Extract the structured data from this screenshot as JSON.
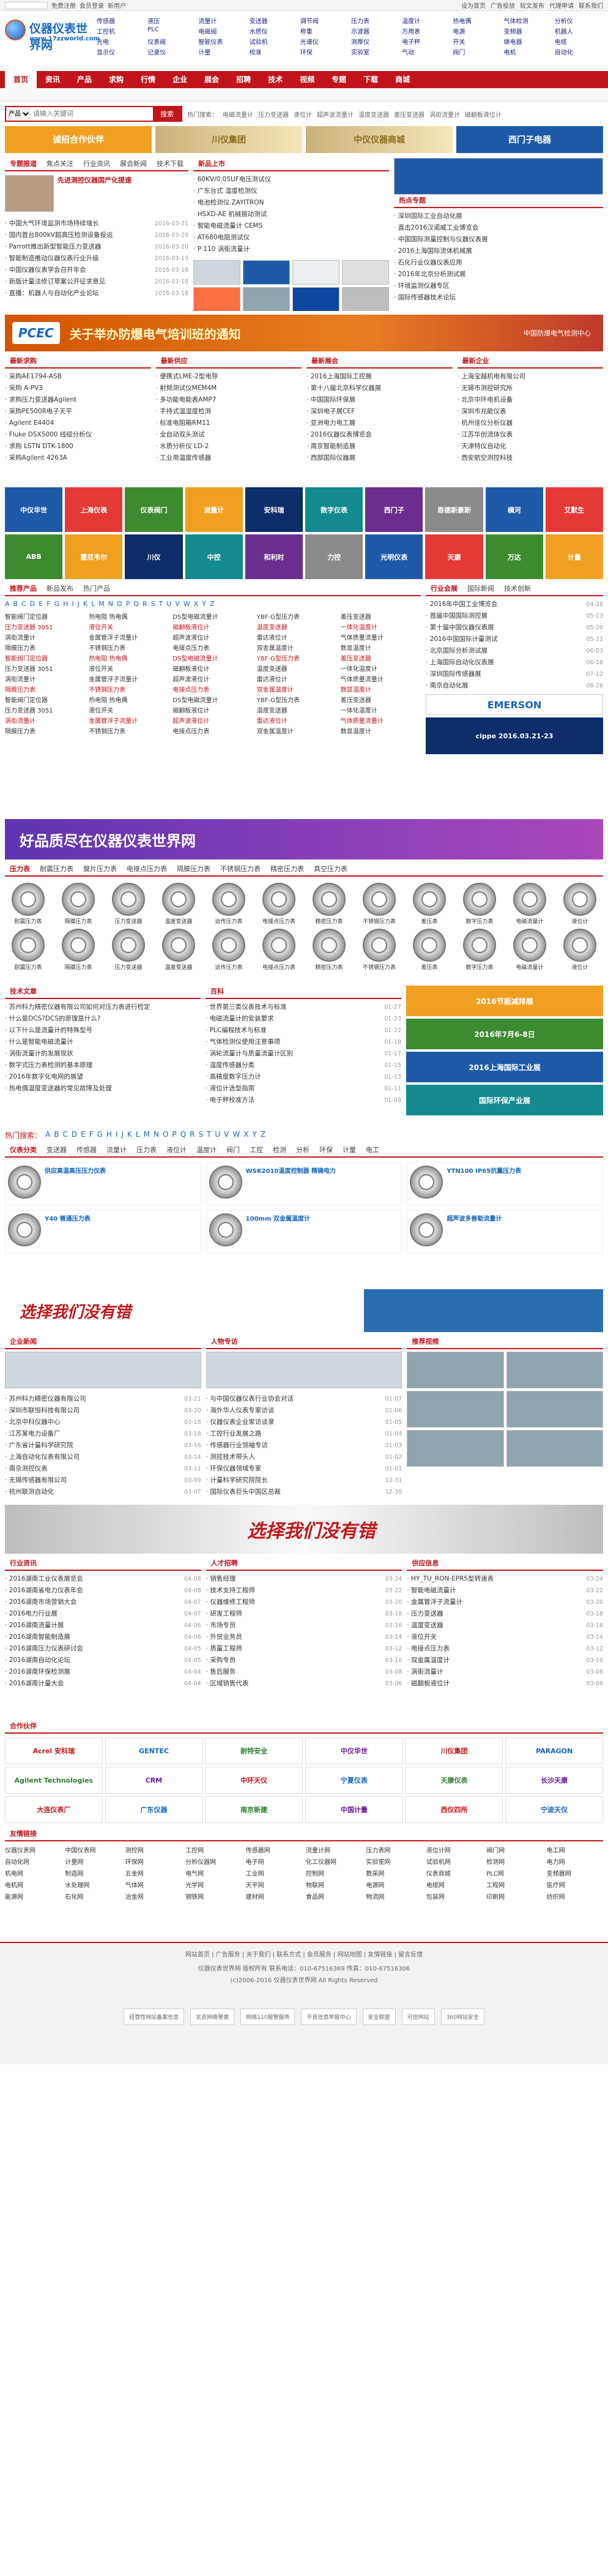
{
  "topbar": {
    "search_placeholder": "",
    "links_left": [
      "免费注册",
      "会员登录",
      "新用户"
    ],
    "links_right": [
      "设为首页",
      "广告投放",
      "软文发布",
      "代理申请",
      "联系我们"
    ]
  },
  "logo": {
    "cn": "仪器仪表世界网",
    "url": "www.17zzworld.com"
  },
  "categories": [
    "传感器",
    "液压",
    "流量计",
    "变送器",
    "调节阀",
    "压力表",
    "温度计",
    "热电偶",
    "气体检测",
    "分析仪",
    "工控机",
    "PLC",
    "电磁阀",
    "水质仪",
    "称重",
    "示波器",
    "万用表",
    "电源",
    "变频器",
    "机器人",
    "光电",
    "仪表阀",
    "智能仪表",
    "试验机",
    "光谱仪",
    "测厚仪",
    "电子秤",
    "开关",
    "继电器",
    "电缆",
    "显示仪",
    "记录仪",
    "计量",
    "校准",
    "环保",
    "实验室",
    "气动",
    "阀门",
    "电机",
    "自动化"
  ],
  "nav": [
    "首页",
    "资讯",
    "产品",
    "求购",
    "行情",
    "企业",
    "展会",
    "招聘",
    "技术",
    "视频",
    "专题",
    "下载",
    "商城"
  ],
  "search": {
    "select": "产品",
    "placeholder": "请输入关键词",
    "button": "搜索",
    "hot": [
      "热门搜索：",
      "电磁流量计",
      "压力变送器",
      "液位计",
      "超声波流量计",
      "温度变送器",
      "差压变送器",
      "涡街流量计",
      "磁翻板液位计"
    ]
  },
  "banners_top": [
    "诚招合作伙伴",
    "川仪集团",
    "中仪仪器商城",
    "西门子电器"
  ],
  "news": {
    "tabs": [
      "专题报道",
      "焦点关注",
      "行业资讯",
      "展会新闻",
      "技术下载"
    ],
    "head_title": "先进测控仪器国产化提速",
    "items": [
      {
        "t": "中国大气环境监测市场持续增长",
        "d": "2016-03-21"
      },
      {
        "t": "国内首台800kV超高压检测设备投运",
        "d": "2016-03-20"
      },
      {
        "t": "Parrott推出新型智能压力变送器",
        "d": "2016-03-20"
      },
      {
        "t": "智能制造推动仪器仪表行业升级",
        "d": "2016-03-19"
      },
      {
        "t": "中国仪器仪表学会召开年会",
        "d": "2016-03-18"
      },
      {
        "t": "新版计量法修订草案公开征求意见",
        "d": "2016-03-18"
      },
      {
        "t": "直播：机器人与自动化产业论坛",
        "d": "2016-03-18"
      }
    ]
  },
  "mid_products": {
    "title": "新品上市",
    "items": [
      "60KV/0.05UF电压测试仪",
      "广东台式 湿度检测仪",
      "电池检测仪 ZAYITRON",
      "HSXD-AE 机械振动测试",
      "智能电磁流量计 CEMS",
      "AT680电阻测试仪",
      "P 110 涡街流量计"
    ]
  },
  "right_topics": {
    "title": "热点专题",
    "items": [
      "深圳国际工业自动化展",
      "直击2016汉诺威工业博览会",
      "中国国际测量控制与仪器仪表展",
      "2016上海国际流体机械展",
      "石化行业仪器仪表应用",
      "2016年北京分析测试展",
      "环境监测仪器专区",
      "国际传感器技术论坛"
    ]
  },
  "pcec": {
    "text": "关于举办防爆电气培训班的通知",
    "sub": "中国防爆电气检测中心"
  },
  "lists4": [
    {
      "tab": "最新求购",
      "items": [
        "采购AE1794-ASB",
        "采购 A-PV3",
        "求购压力变送器Agilent",
        "采购PE500R电子天平",
        "Agilent E4404",
        "Fluke DSX5000 线缆分析仪",
        "求购 LSTN DTK-1800",
        "采购Agilent 4263A"
      ]
    },
    {
      "tab": "最新供应",
      "items": [
        "便携式LME-2型电导",
        "射频测试仪MEM4M",
        "多功能电能表AMP7",
        "手持式温湿度检测",
        "标准电阻箱RM11",
        "全自动双头测试",
        "水质分析仪 LD-2",
        "工业用温度传感器"
      ]
    },
    {
      "tab": "最新展会",
      "items": [
        "2016上海国际工控展",
        "第十八届北京科学仪器展",
        "中国国际环保展",
        "深圳电子展CEF",
        "亚洲电力电工展",
        "2016仪器仪表博览会",
        "南京智能制造展",
        "西部国际仪器展"
      ]
    },
    {
      "tab": "最新企业",
      "items": [
        "上海宝越机电有限公司",
        "无锡市测控研究所",
        "北京中环电机设备",
        "深圳市兆能仪表",
        "杭州佳仪分析仪器",
        "江苏华创流体仪表",
        "天津特仪自动化",
        "西安航空测控科技"
      ]
    }
  ],
  "logo_grid": [
    "中仪华世",
    "上海仪表",
    "仪表阀门",
    "流量计",
    "安科瑞",
    "数字仪表",
    "西门子",
    "恩德斯豪斯",
    "横河",
    "艾默生",
    "ABB",
    "霍尼韦尔",
    "川仪",
    "中控",
    "和利时",
    "力控",
    "光明仪表",
    "天康",
    "万达",
    "计量"
  ],
  "alpha": {
    "tabs": [
      "推荐产品",
      "新品发布",
      "热门产品"
    ],
    "letters": [
      "A",
      "B",
      "C",
      "D",
      "E",
      "F",
      "G",
      "H",
      "I",
      "J",
      "K",
      "L",
      "M",
      "N",
      "O",
      "P",
      "Q",
      "R",
      "S",
      "T",
      "U",
      "V",
      "W",
      "X",
      "Y",
      "Z"
    ]
  },
  "product_lines": [
    [
      "智能阀门定位器",
      "热电阻 热电偶",
      "DS型电磁流量计",
      "YBF-G型压力表",
      "差压变送器"
    ],
    [
      "压力变送器 3051",
      "液位开关",
      "磁翻板液位计",
      "温度变送器",
      "一体化温度计"
    ],
    [
      "涡街流量计",
      "金属管浮子流量计",
      "超声波液位计",
      "雷达液位计",
      "气体质量流量计"
    ],
    [
      "隔膜压力表",
      "不锈钢压力表",
      "电接点压力表",
      "双金属温度计",
      "数显温度计"
    ]
  ],
  "right_side": {
    "tabs": [
      "行业会展",
      "国际新闻",
      "技术创新"
    ],
    "items": [
      "2016年中国工业博览会",
      "首届中国国际测控展",
      "第十届中国仪器仪表展",
      "2016中国国际计量测试",
      "北京国际分析测试展",
      "上海国际自动化仪表展",
      "深圳国际传感器展",
      "南京自动化展"
    ],
    "dates": [
      "04-28",
      "05-13",
      "05-20",
      "05-21",
      "06-03",
      "06-18",
      "07-12",
      "08-26"
    ]
  },
  "emerson": "EMERSON",
  "cippe": "cippe 2016.03.21-23",
  "banner_quality": "好品质尽在仪器仪表世界网",
  "prod_tabs": [
    "压力表",
    "耐震压力表",
    "膜片压力表",
    "电接点压力表",
    "隔膜压力表",
    "不锈钢压力表",
    "精密压力表",
    "真空压力表"
  ],
  "gauges": [
    "耐震压力表",
    "隔膜压力表",
    "压力变送器",
    "温度变送器",
    "远传压力表",
    "电接点压力表",
    "精密压力表",
    "不锈钢压力表",
    "差压表",
    "数字压力表",
    "电磁流量计",
    "液位计"
  ],
  "tech_news": {
    "tab": "技术文章",
    "items": [
      "苏州科力精密仪器有限公司如何对压力表进行检定",
      "什么是DCS?DCS的原理是什么?",
      "以下什么是流量计的特殊型号",
      "什么是智能电磁流量计",
      "涡街流量计的发展现状",
      "数字式压力表检测的基本原理",
      "2016年数字化电网的展望",
      "热电偶温度变送器的常见故障及处理"
    ]
  },
  "tech_news2": {
    "tab": "百科",
    "items": [
      "世界第三类仪表技术与标准",
      "电磁流量计的安装要求",
      "PLC编程技术与标准",
      "气体检测仪使用注意事项",
      "涡轮流量计与质量流量计区别",
      "温度传感器分类",
      "高精度数字压力计",
      "液位计选型指南",
      "电子秤校准方法"
    ],
    "dates": [
      "01-27",
      "01-23",
      "01-22",
      "01-19",
      "01-17",
      "01-15",
      "01-13",
      "01-11",
      "01-09"
    ]
  },
  "expo_right": [
    "2016节能减排展",
    "2016年7月6-8日",
    "2016上海国际工业展",
    "国际环保产业展"
  ],
  "alpha2": {
    "title": "热门搜索：",
    "letters": [
      "A",
      "B",
      "C",
      "D",
      "E",
      "F",
      "G",
      "H",
      "I",
      "J",
      "K",
      "L",
      "M",
      "N",
      "O",
      "P",
      "Q",
      "R",
      "S",
      "T",
      "U",
      "V",
      "W",
      "X",
      "Y",
      "Z"
    ]
  },
  "cat_row": [
    "仪表分类",
    "变送器",
    "传感器",
    "流量计",
    "压力表",
    "液位计",
    "温度计",
    "阀门",
    "工控",
    "检测",
    "分析",
    "环保",
    "计量",
    "电工"
  ],
  "feat": [
    {
      "title": "供应高温高压压力仪表",
      "price": ""
    },
    {
      "title": "WSK2010温度控制器 精确电力",
      "price": ""
    },
    {
      "title": "YTN100 IP65抗震压力表",
      "price": ""
    },
    {
      "title": "Y40 普通压力表",
      "price": ""
    },
    {
      "title": "100mm 双金属温度计",
      "price": ""
    },
    {
      "title": "超声波多普勒流量计",
      "price": ""
    }
  ],
  "banner_select": "选择我们没有错",
  "col3": [
    {
      "tab": "企业新闻",
      "items": [
        "苏州科力精密仪器有限公司",
        "深圳市联恒科技有限公司",
        "北京中科仪器中心",
        "江苏某电力设备厂",
        "广东省计量科学研究院",
        "上海自动化仪表有限公司",
        "南京测控仪表",
        "无锡传感器有限公司",
        "杭州联测自动化"
      ],
      "dates": [
        "03-21",
        "03-20",
        "03-18",
        "03-18",
        "03-16",
        "03-14",
        "03-11",
        "03-09",
        "03-07"
      ]
    },
    {
      "tab": "人物专访",
      "items": [
        "与中国仪器仪表行业协会对话",
        "海外华人仪表专家访谈",
        "仪器仪表企业家访谈录",
        "工控行业发展之路",
        "传感器行业领袖专访",
        "测控技术带头人",
        "环保仪器领域专家",
        "计量科学研究院院长",
        "国际仪表巨头中国区总裁"
      ],
      "dates": [
        "01-07",
        "01-06",
        "01-05",
        "01-04",
        "01-03",
        "01-02",
        "01-01",
        "12-31",
        "12-30"
      ]
    },
    {
      "tab": "推荐视频",
      "items": []
    }
  ],
  "col4": [
    {
      "tab": "行业资讯",
      "items": [
        "2016湖南工业仪表展览会",
        "2016湖南省电力仪表年会",
        "2016湖南市场营销大会",
        "2016电力行业展",
        "2016湖南流量计展",
        "2016湖南智能制造展",
        "2016湖南压力仪表研讨会",
        "2016湖南自动化论坛",
        "2016湖南环保检测展",
        "2016湖南计量大会"
      ],
      "dates": [
        "04-08",
        "04-08",
        "04-07",
        "04-07",
        "04-06",
        "04-06",
        "04-05",
        "04-05",
        "04-04",
        "04-04"
      ]
    },
    {
      "tab": "人才招聘",
      "items": [
        "销售经理",
        "技术支持工程师",
        "仪器维修工程师",
        "研发工程师",
        "市场专员",
        "外贸业务员",
        "质量工程师",
        "采购专员",
        "售后服务",
        "区域销售代表"
      ],
      "dates": [
        "03-24",
        "03-22",
        "03-20",
        "03-18",
        "03-16",
        "03-14",
        "03-12",
        "03-10",
        "03-08",
        "03-06"
      ]
    },
    {
      "tab": "供应信息",
      "items": [
        "HY_TU_RON-EPR5型转速表",
        "智能电磁流量计",
        "金属管浮子流量计",
        "压力变送器",
        "温度变送器",
        "液位开关",
        "电接点压力表",
        "双金属温度计",
        "涡街流量计",
        "磁翻板液位计"
      ],
      "dates": [
        "03-24",
        "03-22",
        "03-20",
        "03-18",
        "03-16",
        "03-14",
        "03-12",
        "03-10",
        "03-08",
        "03-06"
      ]
    }
  ],
  "partner_title": "合作伙伴",
  "partners": [
    "Acrel 安科瑞",
    "GENTEC",
    "耐特安全",
    "中仪华世",
    "川仪集团",
    "PARAGON",
    "Agilent Technologies",
    "CRM",
    "中环天仪",
    "宁夏仪表",
    "天康仪表",
    "长沙天康",
    "大连仪表厂",
    "广东仪器",
    "南京新建",
    "中国计量",
    "西仪四所",
    "宁波天仪"
  ],
  "friend_title": "友情链接",
  "friends": [
    "仪器仪表网",
    "中国仪表网",
    "测控网",
    "工控网",
    "传感器网",
    "流量计网",
    "压力表网",
    "液位计网",
    "阀门网",
    "电工网",
    "自动化网",
    "计量网",
    "环保网",
    "分析仪器网",
    "电子网",
    "化工仪器网",
    "实验室网",
    "试验机网",
    "检测网",
    "电力网",
    "机电网",
    "制造网",
    "五金网",
    "电气网",
    "工业网",
    "控制网",
    "数采网",
    "仪表商城",
    "PLC网",
    "变频器网",
    "电机网",
    "水处理网",
    "气体网",
    "光学网",
    "天平网",
    "物联网",
    "电源网",
    "电缆网",
    "工程网",
    "医疗网",
    "能源网",
    "石化网",
    "冶金网",
    "钢铁网",
    "建材网",
    "食品网",
    "物流网",
    "包装网",
    "印刷网",
    "纺织网"
  ],
  "footer": {
    "links": "网站首页 | 广告服务 | 关于我们 | 联系方式 | 会员服务 | 网站地图 | 友情链接 | 留言反馈",
    "line2": "仪器仪表世界网 版权所有 联系电话：010-67516369 传真：010-67516306",
    "line3": "(c)2006-2016 仪器仪表世界网 All Rights Reserved",
    "badges": [
      "经营性网站备案信息",
      "北京网络警察",
      "网络110报警服务",
      "不良信息举报中心",
      "安全联盟",
      "可信网站",
      "360网站安全"
    ]
  }
}
